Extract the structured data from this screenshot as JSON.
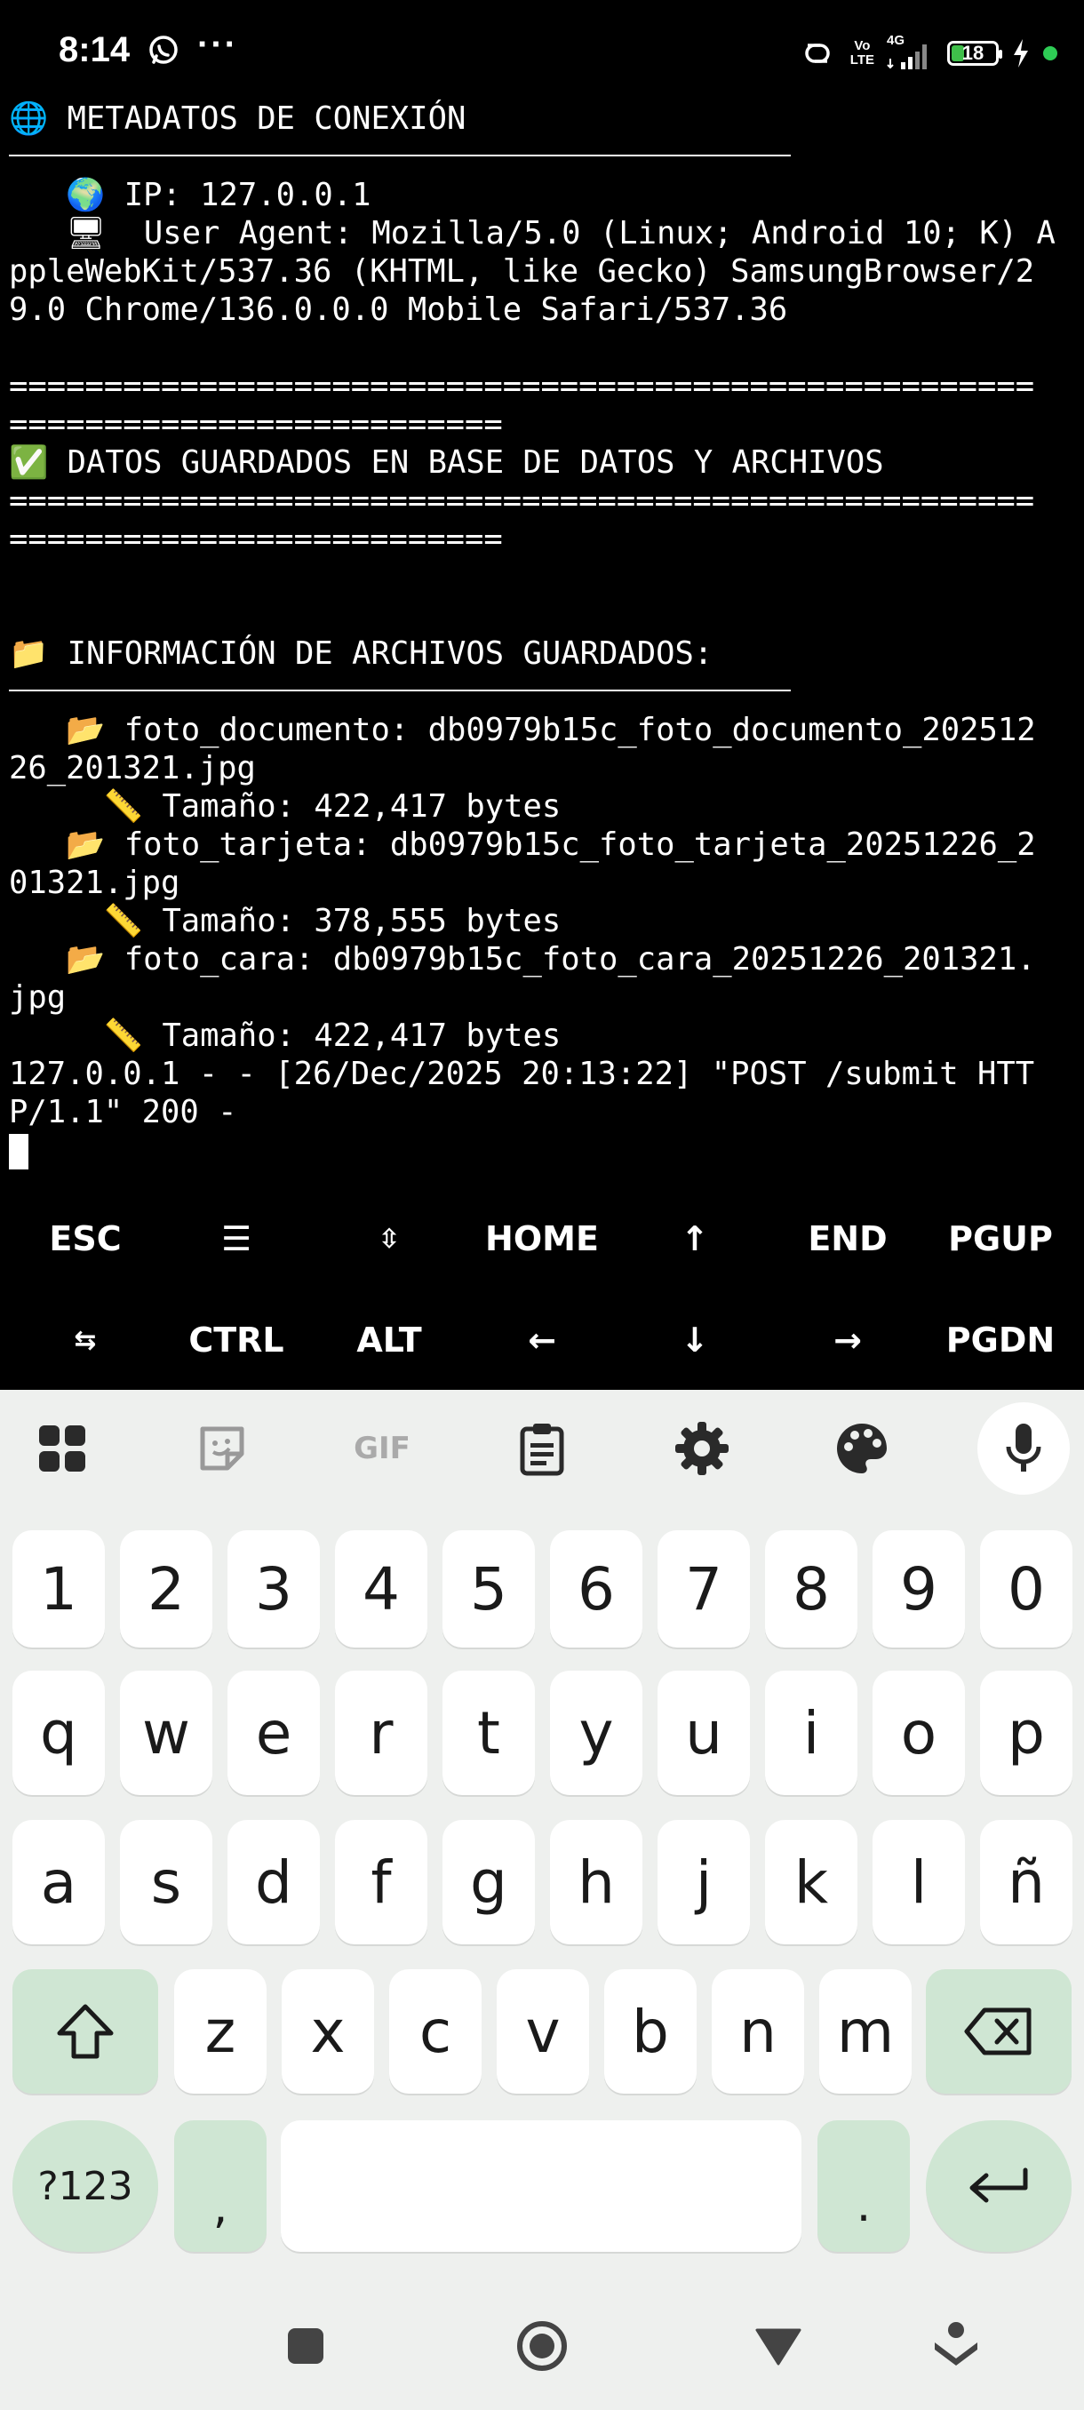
{
  "status_bar": {
    "time": "8:14",
    "more": "···",
    "volte_top": "Vo",
    "volte_bottom": "LTE",
    "network": "4G",
    "battery": "18"
  },
  "terminal": {
    "section1_title": "🌐 METADATOS DE CONEXIÓN",
    "ip_line": "   🌍 IP: 127.0.0.1",
    "ua_line1": "   🖥  User Agent: Mozilla/5.0 (Linux; Android 10; K) A",
    "ua_line2": "ppleWebKit/537.36 (KHTML, like Gecko) SamsungBrowser/2",
    "ua_line3": "9.0 Chrome/136.0.0.0 Mobile Safari/537.36",
    "sep_long": "======================================================",
    "sep_short": "==========================",
    "saved_line": "✅ DATOS GUARDADOS EN BASE DE DATOS Y ARCHIVOS",
    "section2_title": "📁 INFORMACIÓN DE ARCHIVOS GUARDADOS:",
    "f1_line1": "   📂 foto_documento: db0979b15c_foto_documento_202512",
    "f1_line2": "26_201321.jpg",
    "f1_size": "     📏 Tamaño: 422,417 bytes",
    "f2_line1": "   📂 foto_tarjeta: db0979b15c_foto_tarjeta_20251226_2",
    "f2_line2": "01321.jpg",
    "f2_size": "     📏 Tamaño: 378,555 bytes",
    "f3_line1": "   📂 foto_cara: db0979b15c_foto_cara_20251226_201321.",
    "f3_line2": "jpg",
    "f3_size": "     📏 Tamaño: 422,417 bytes",
    "log_line1": "127.0.0.1 - - [26/Dec/2025 20:13:22] \"POST /submit HTT",
    "log_line2": "P/1.1\" 200 -"
  },
  "extra_keys": {
    "row1": [
      "ESC",
      "☰",
      "⇳",
      "HOME",
      "↑",
      "END",
      "PGUP"
    ],
    "row2": [
      "⇆",
      "CTRL",
      "ALT",
      "←",
      "↓",
      "→",
      "PGDN"
    ]
  },
  "keyboard": {
    "toolbar": [
      "apps-icon",
      "sticker-icon",
      "GIF",
      "clipboard-icon",
      "settings-icon",
      "palette-icon",
      "mic-icon"
    ],
    "gif_label": "GIF",
    "numbers": [
      "1",
      "2",
      "3",
      "4",
      "5",
      "6",
      "7",
      "8",
      "9",
      "0"
    ],
    "row1": [
      "q",
      "w",
      "e",
      "r",
      "t",
      "y",
      "u",
      "i",
      "o",
      "p"
    ],
    "row2": [
      "a",
      "s",
      "d",
      "f",
      "g",
      "h",
      "j",
      "k",
      "l",
      "ñ"
    ],
    "row3": [
      "z",
      "x",
      "c",
      "v",
      "b",
      "n",
      "m"
    ],
    "symbols_label": "?123",
    "comma": ",",
    "period": "."
  },
  "colors": {
    "terminal_bg": "#000000",
    "terminal_fg": "#ffffff",
    "keyboard_bg": "#eef0ee",
    "key_bg": "#ffffff",
    "accent_key_bg": "#cfe6d3",
    "battery_fill": "#3fbf4a"
  }
}
